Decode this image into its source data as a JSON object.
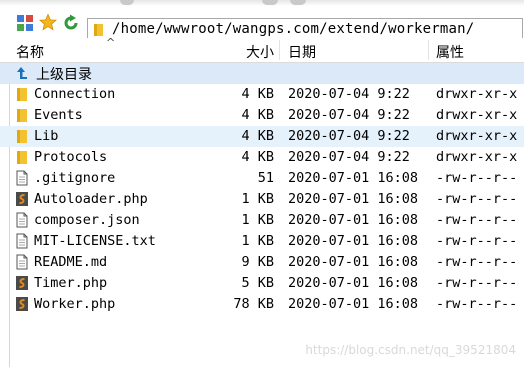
{
  "address": {
    "path": "/home/wwwroot/wangps.com/extend/workerman/"
  },
  "columns": {
    "name": "名称",
    "size": "大小",
    "date": "日期",
    "perm": "属性"
  },
  "parent": {
    "label": "上级目录"
  },
  "files": [
    {
      "name": "Connection",
      "size": "4 KB",
      "date": "2020-07-04 9:22",
      "perm": "drwxr-xr-x",
      "type": "folder"
    },
    {
      "name": "Events",
      "size": "4 KB",
      "date": "2020-07-04 9:22",
      "perm": "drwxr-xr-x",
      "type": "folder"
    },
    {
      "name": "Lib",
      "size": "4 KB",
      "date": "2020-07-04 9:22",
      "perm": "drwxr-xr-x",
      "type": "folder"
    },
    {
      "name": "Protocols",
      "size": "4 KB",
      "date": "2020-07-04 9:22",
      "perm": "drwxr-xr-x",
      "type": "folder"
    },
    {
      "name": ".gitignore",
      "size": "51",
      "date": "2020-07-01 16:08",
      "perm": "-rw-r--r--",
      "type": "text"
    },
    {
      "name": "Autoloader.php",
      "size": "1 KB",
      "date": "2020-07-01 16:08",
      "perm": "-rw-r--r--",
      "type": "php"
    },
    {
      "name": "composer.json",
      "size": "1 KB",
      "date": "2020-07-01 16:08",
      "perm": "-rw-r--r--",
      "type": "text"
    },
    {
      "name": "MIT-LICENSE.txt",
      "size": "1 KB",
      "date": "2020-07-01 16:08",
      "perm": "-rw-r--r--",
      "type": "text"
    },
    {
      "name": "README.md",
      "size": "9 KB",
      "date": "2020-07-01 16:08",
      "perm": "-rw-r--r--",
      "type": "text"
    },
    {
      "name": "Timer.php",
      "size": "5 KB",
      "date": "2020-07-01 16:08",
      "perm": "-rw-r--r--",
      "type": "php"
    },
    {
      "name": "Worker.php",
      "size": "78 KB",
      "date": "2020-07-01 16:08",
      "perm": "-rw-r--r--",
      "type": "php"
    }
  ],
  "watermark": "https://blog.csdn.net/qq_39521804",
  "colors": {
    "folder": "#f2c230",
    "selection": "#dbe9f8",
    "php": "#e08a1e"
  }
}
